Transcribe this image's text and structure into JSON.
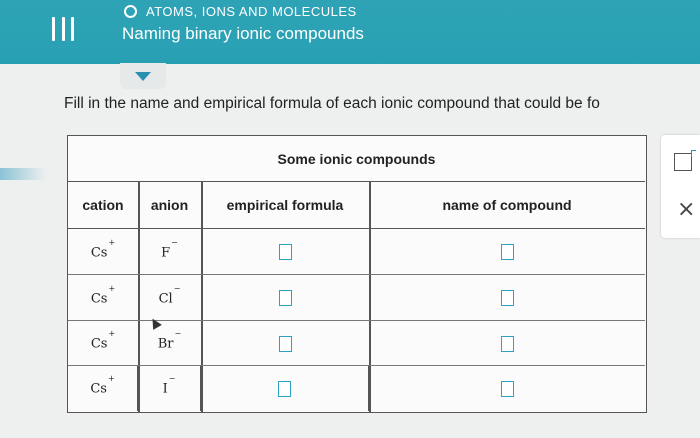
{
  "header": {
    "topic": "ATOMS, IONS AND MOLECULES",
    "lesson_title": "Naming binary ionic compounds"
  },
  "instruction": "Fill in the name and empirical formula of each ionic compound that could be fo",
  "table": {
    "title": "Some ionic compounds",
    "headers": {
      "cation": "cation",
      "anion": "anion",
      "formula": "empirical formula",
      "name": "name of compound"
    },
    "rows": [
      {
        "cation": "Cs",
        "cation_charge": "+",
        "anion": "F",
        "anion_charge": "−",
        "formula": "",
        "name": ""
      },
      {
        "cation": "Cs",
        "cation_charge": "+",
        "anion": "Cl",
        "anion_charge": "−",
        "formula": "",
        "name": ""
      },
      {
        "cation": "Cs",
        "cation_charge": "+",
        "anion": "Br",
        "anion_charge": "−",
        "formula": "",
        "name": ""
      },
      {
        "cation": "Cs",
        "cation_charge": "+",
        "anion": "I",
        "anion_charge": "−",
        "formula": "",
        "name": ""
      }
    ]
  },
  "side_panel": {
    "close_glyph": "×"
  },
  "colors": {
    "header_bg": "#2fa3b6",
    "accent": "#2e9fc5"
  }
}
